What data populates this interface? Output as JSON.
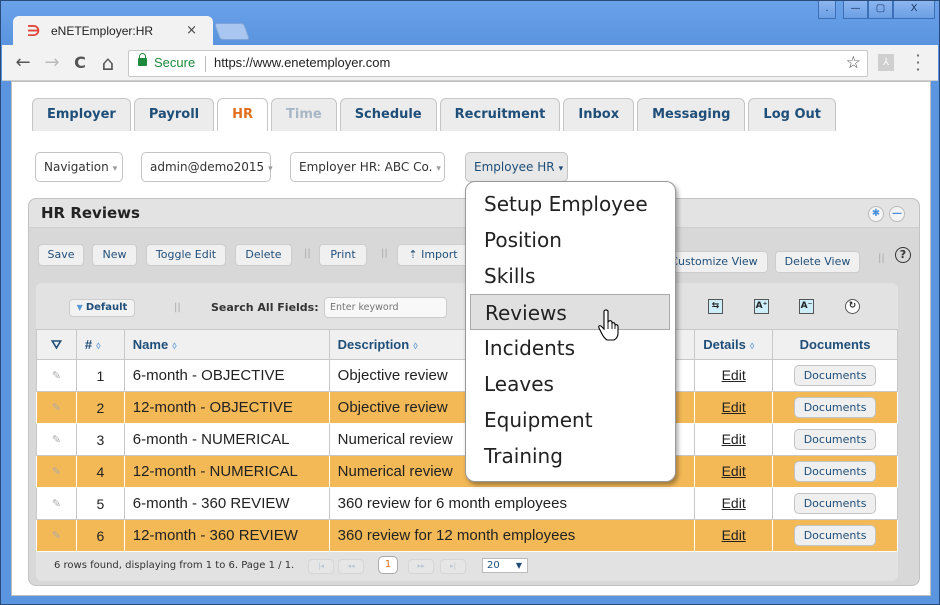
{
  "browser": {
    "tab_title": "eNETEmployer:HR",
    "tab_close": "×",
    "secure_label": "Secure",
    "url": "https://www.enetemployer.com",
    "window_controls": [
      ".",
      "—",
      "▢",
      "X"
    ],
    "icons": {
      "back": "←",
      "forward": "→",
      "reload": "C",
      "home": "⌂",
      "star": "☆",
      "pdf": "⅄",
      "menu": "⋮",
      "logo": "∋"
    }
  },
  "main_tabs": [
    {
      "label": "Employer",
      "state": "normal"
    },
    {
      "label": "Payroll",
      "state": "normal"
    },
    {
      "label": "HR",
      "state": "active"
    },
    {
      "label": "Time",
      "state": "disabled"
    },
    {
      "label": "Schedule",
      "state": "normal"
    },
    {
      "label": "Recruitment",
      "state": "normal"
    },
    {
      "label": "Inbox",
      "state": "normal"
    },
    {
      "label": "Messaging",
      "state": "normal"
    },
    {
      "label": "Log Out",
      "state": "normal"
    }
  ],
  "selectors": {
    "navigation": "Navigation",
    "user": "admin@demo2015",
    "employer": "Employer HR: ABC Co.",
    "employee_hr": "Employee HR",
    "caret": "▾"
  },
  "panel": {
    "title": "HR Reviews",
    "actions": {
      "save": "Save",
      "new": "New",
      "toggle_edit": "Toggle Edit",
      "delete": "Delete",
      "print": "Print",
      "import": "Import",
      "customize_view": "Customize View",
      "delete_view": "Delete View"
    },
    "separator": "||",
    "help": "?",
    "view_select": "Default",
    "search_label": "Search All Fields:",
    "search_placeholder": "Enter keyword",
    "grid_icons": {
      "wrap": "⇆",
      "font_up": "A⁺",
      "font_down": "A⁻",
      "reset": "↻"
    }
  },
  "table": {
    "headers": {
      "num": "#",
      "name": "Name",
      "description": "Description",
      "details": "Details",
      "documents": "Documents"
    },
    "sort_glyph": "◊",
    "rows": [
      {
        "num": "1",
        "name": "6-month - OBJECTIVE",
        "description": "Objective review",
        "details": "Edit",
        "documents": "Documents",
        "highlight": false
      },
      {
        "num": "2",
        "name": "12-month - OBJECTIVE",
        "description": "Objective review",
        "details": "Edit",
        "documents": "Documents",
        "highlight": true
      },
      {
        "num": "3",
        "name": "6-month - NUMERICAL",
        "description": "Numerical review",
        "details": "Edit",
        "documents": "Documents",
        "highlight": false
      },
      {
        "num": "4",
        "name": "12-month - NUMERICAL",
        "description": "Numerical review",
        "details": "Edit",
        "documents": "Documents",
        "highlight": true
      },
      {
        "num": "5",
        "name": "6-month - 360 REVIEW",
        "description": "360 review for 6 month employees",
        "details": "Edit",
        "documents": "Documents",
        "highlight": false
      },
      {
        "num": "6",
        "name": "12-month - 360 REVIEW",
        "description": "360 review for 12 month employees",
        "details": "Edit",
        "documents": "Documents",
        "highlight": true
      }
    ]
  },
  "pager": {
    "info": "6 rows found, displaying from 1 to 6. Page 1 / 1.",
    "first": "|◂",
    "prev": "◂◂",
    "current_page": "1",
    "next": "▸▸",
    "last": "▸|",
    "page_size": "20",
    "page_size_caret": "▼"
  },
  "dropdown_menu": {
    "items": [
      "Setup Employee",
      "Position",
      "Skills",
      "Reviews",
      "Incidents",
      "Leaves",
      "Equipment",
      "Training"
    ],
    "hovered": "Reviews"
  },
  "colors": {
    "accent_orange": "#e07020",
    "row_highlight": "#f3b957",
    "link_blue": "#1f4e79",
    "chrome_blue": "#5b95e0"
  }
}
